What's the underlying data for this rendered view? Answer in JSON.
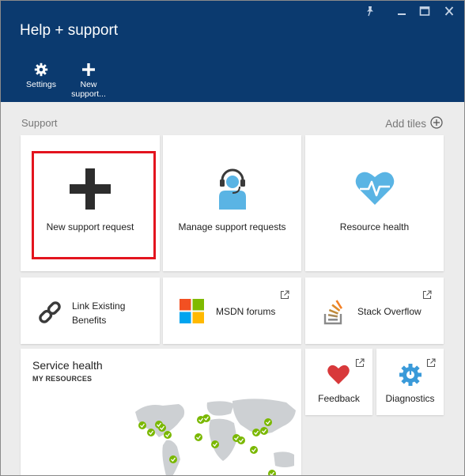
{
  "window": {
    "title": "Help + support"
  },
  "commands": [
    {
      "label": "Settings",
      "icon": "gear-icon"
    },
    {
      "label": "New\nsupport...",
      "icon": "plus-icon"
    }
  ],
  "section": {
    "label": "Support",
    "add_tiles": "Add tiles"
  },
  "tiles": {
    "new_request": "New support request",
    "manage_requests": "Manage support requests",
    "resource_health": "Resource health",
    "link_benefits": "Link Existing\nBenefits",
    "msdn": "MSDN forums",
    "stack_overflow": "Stack Overflow",
    "service_health_title": "Service health",
    "service_health_subtitle": "MY RESOURCES",
    "feedback": "Feedback",
    "diagnostics": "Diagnostics"
  },
  "colors": {
    "header": "#0b3a6f",
    "accent": "#0078d7",
    "highlight": "#e3141e",
    "heart": "#d8393b",
    "ok_green": "#7ab800"
  }
}
